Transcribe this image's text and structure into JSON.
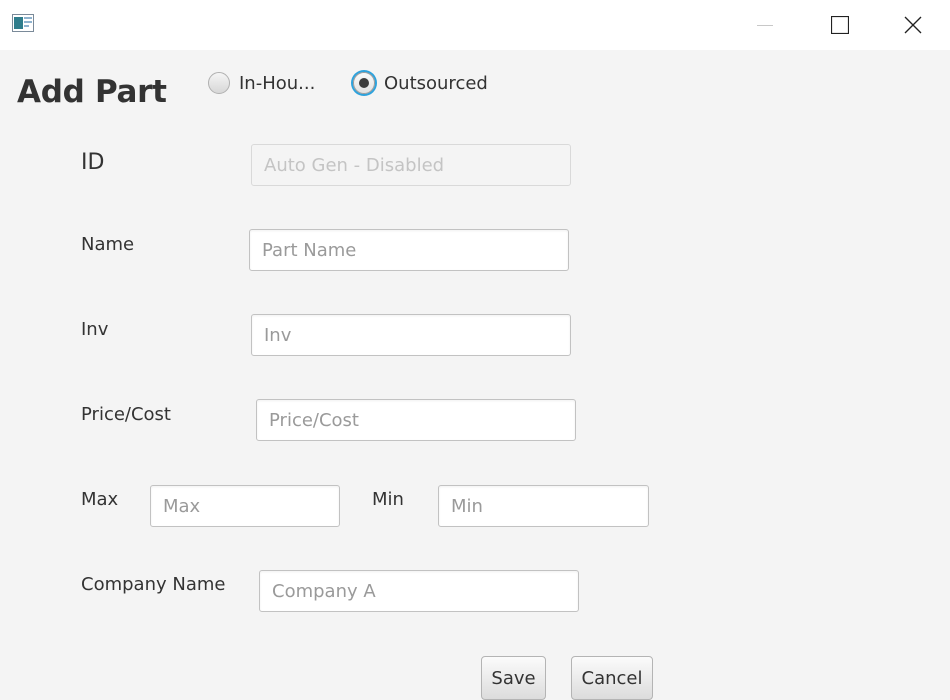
{
  "window": {
    "icon": "app-window-icon",
    "controls": [
      "minimize-icon",
      "maximize-icon",
      "close-icon"
    ]
  },
  "form": {
    "heading": "Add Part",
    "source_options": [
      {
        "label": "In-Hou...",
        "selected": false
      },
      {
        "label": "Outsourced",
        "selected": true
      }
    ],
    "fields": {
      "id": {
        "label": "ID",
        "value": "",
        "placeholder": "Auto Gen - Disabled",
        "disabled": true
      },
      "name": {
        "label": "Name",
        "value": "",
        "placeholder": "Part Name"
      },
      "inv": {
        "label": "Inv",
        "value": "",
        "placeholder": "Inv"
      },
      "price": {
        "label": "Price/Cost",
        "value": "",
        "placeholder": "Price/Cost"
      },
      "max": {
        "label": "Max",
        "value": "",
        "placeholder": "Max"
      },
      "min": {
        "label": "Min",
        "value": "",
        "placeholder": "Min"
      },
      "company": {
        "label": "Company Name",
        "value": "",
        "placeholder": "Company A"
      }
    },
    "buttons": {
      "save": "Save",
      "cancel": "Cancel"
    }
  },
  "colors": {
    "focus_ring": "#2ea2dc",
    "background": "#f4f4f4",
    "titlebar": "#ffffff"
  }
}
